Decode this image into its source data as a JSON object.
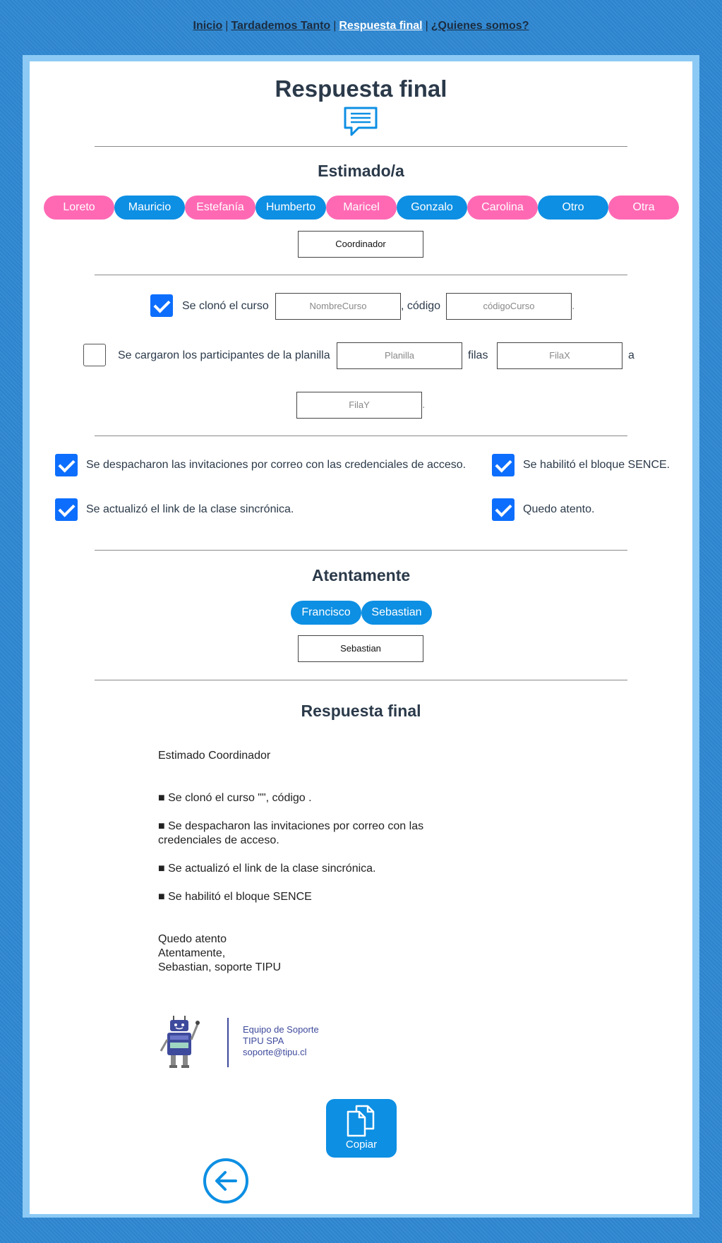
{
  "nav": {
    "items": [
      "Inicio",
      "Tardademos Tanto",
      "Respuesta final",
      "¿Quienes somos?"
    ],
    "separator": "|",
    "active_index": 2
  },
  "header": {
    "title": "Respuesta final",
    "icon": "chat-bubble-icon"
  },
  "greeting": {
    "heading": "Estimado/a",
    "names": [
      {
        "label": "Loreto",
        "color": "pink"
      },
      {
        "label": "Mauricio",
        "color": "blue"
      },
      {
        "label": "Estefanía",
        "color": "pink"
      },
      {
        "label": "Humberto",
        "color": "blue"
      },
      {
        "label": "Maricel",
        "color": "pink"
      },
      {
        "label": "Gonzalo",
        "color": "blue"
      },
      {
        "label": "Carolina",
        "color": "pink"
      },
      {
        "label": "Otro",
        "color": "blue"
      },
      {
        "label": "Otra",
        "color": "pink"
      }
    ],
    "selected_value": "Coordinador"
  },
  "course": {
    "checked": true,
    "label": "Se clonó el curso",
    "name_placeholder": "NombreCurso",
    "code_label": ", código",
    "code_placeholder": "códigoCurso",
    "end": "."
  },
  "participants": {
    "checked": false,
    "label": "Se cargaron los participantes de la planilla",
    "sheet_placeholder": "Planilla",
    "rows_label": "filas",
    "from_placeholder": "FilaX",
    "to_label": "a",
    "to_placeholder": "FilaY",
    "end": "."
  },
  "options": [
    {
      "label": "Se despacharon las invitaciones por correo con las credenciales de acceso.",
      "checked": true
    },
    {
      "label": "Se habilitó el bloque SENCE.",
      "checked": true
    },
    {
      "label": "Se actualizó el link de la clase sincrónica.",
      "checked": true
    },
    {
      "label": "Quedo atento.",
      "checked": true
    }
  ],
  "signoff": {
    "heading": "Atentamente",
    "names": [
      "Francisco",
      "Sebastian"
    ],
    "selected_value": "Sebastian"
  },
  "result": {
    "heading": "Respuesta final",
    "greeting": "Estimado Coordinador",
    "bullets": [
      "■ Se clonó el curso \"\", código .",
      "■ Se despacharon las invitaciones por correo con las credenciales de acceso.",
      "■ Se actualizó el link de la clase sincrónica.",
      "■ Se habilitó el bloque SENCE"
    ],
    "closing": [
      "Quedo atento",
      "Atentamente,",
      "Sebastian, soporte TIPU"
    ]
  },
  "signature": {
    "line1": "Equipo de Soporte",
    "line2": "TIPU SPA",
    "line3": "soporte@tipu.cl"
  },
  "copy_button": {
    "label": "Copiar"
  },
  "back_button": {
    "icon": "arrow-left-icon"
  },
  "colors": {
    "pink": "#ff69b4",
    "blue": "#0d8fe3",
    "checkbox": "#0d6efd",
    "background": "#2f88d2"
  }
}
